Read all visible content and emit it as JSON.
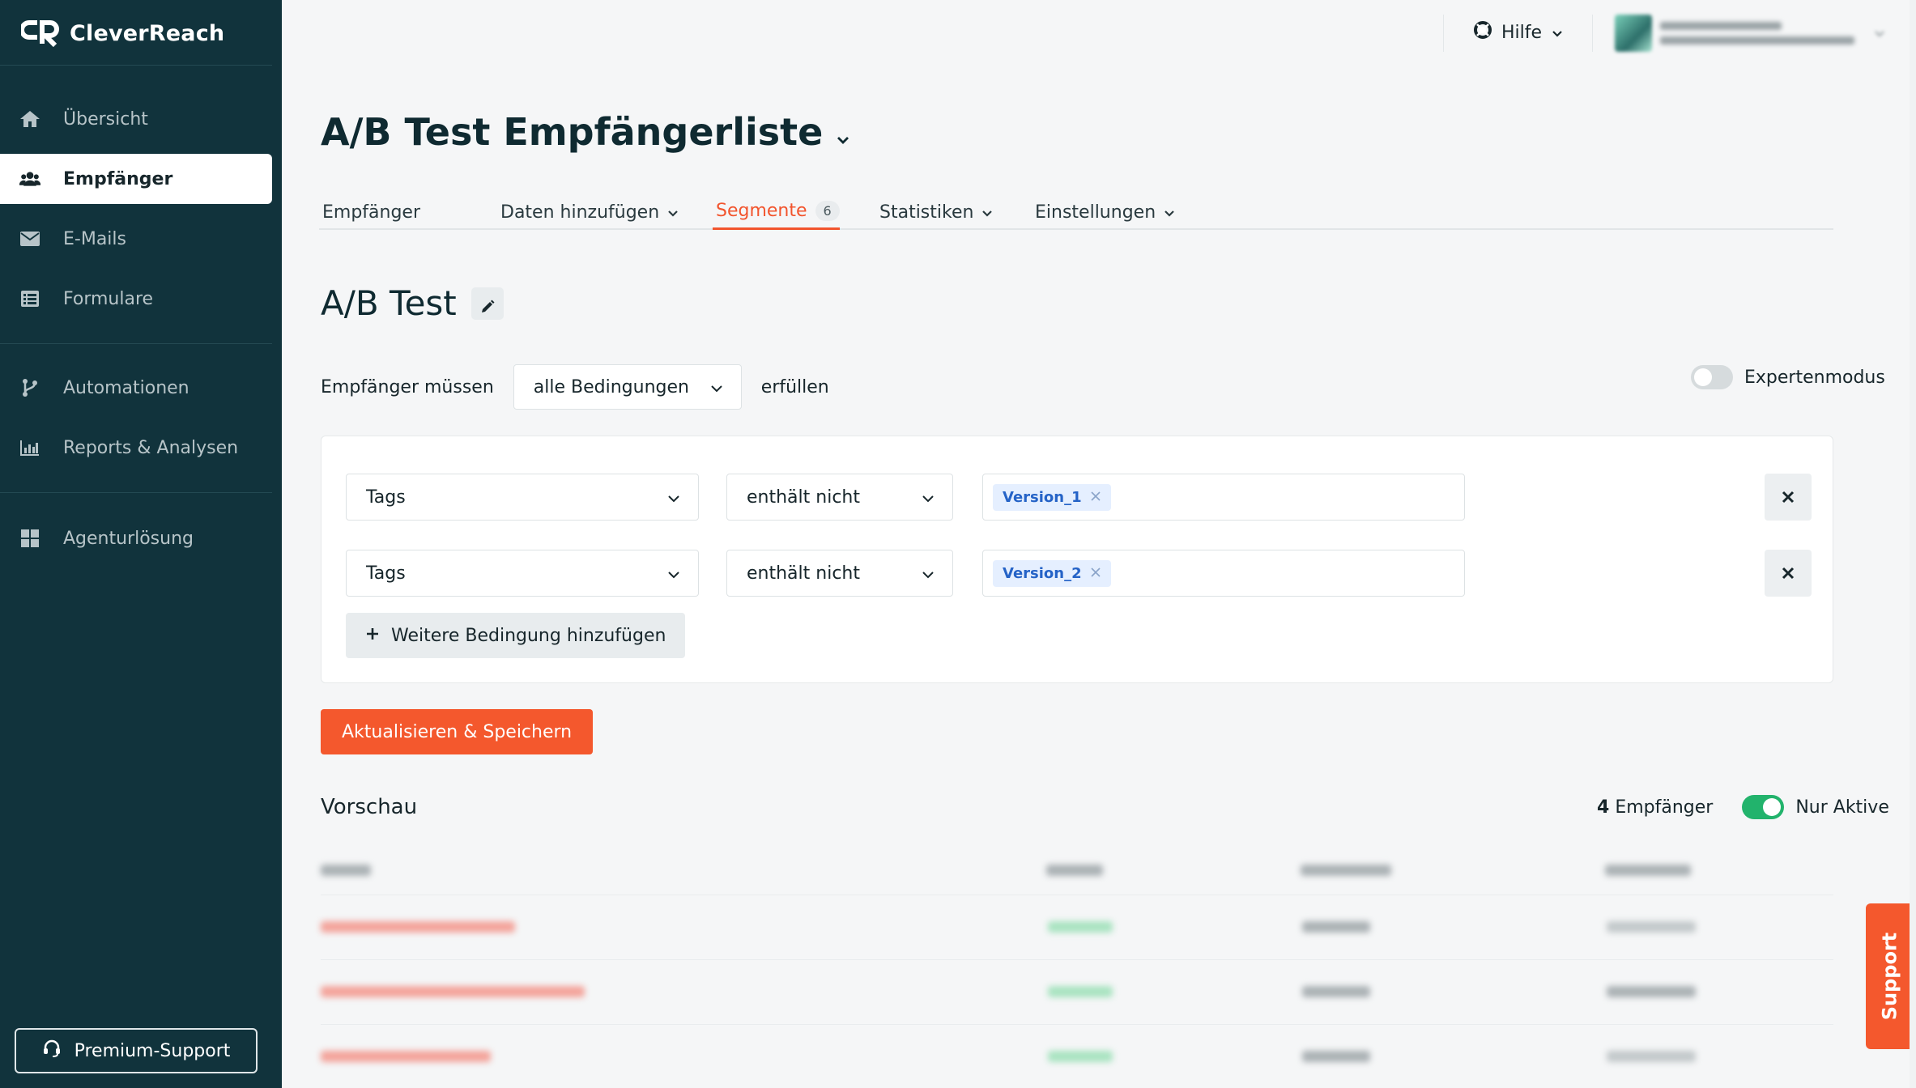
{
  "brand": {
    "name": "CleverReach"
  },
  "sidebar": {
    "items": [
      {
        "label": "Übersicht",
        "icon": "home-icon"
      },
      {
        "label": "Empfänger",
        "icon": "users-icon",
        "active": true
      },
      {
        "label": "E-Mails",
        "icon": "mail-icon"
      },
      {
        "label": "Formulare",
        "icon": "form-icon"
      },
      {
        "label": "Automationen",
        "icon": "branch-icon"
      },
      {
        "label": "Reports & Analysen",
        "icon": "bar-chart-icon"
      },
      {
        "label": "Agenturlösung",
        "icon": "grid-icon"
      }
    ],
    "premium_support": "Premium-Support"
  },
  "topbar": {
    "help_label": "Hilfe"
  },
  "page": {
    "title": "A/B Test Empfängerliste",
    "tabs": [
      {
        "label": "Empfänger"
      },
      {
        "label": "Daten hinzufügen"
      },
      {
        "label": "Segmente",
        "badge": "6",
        "active": true
      },
      {
        "label": "Statistiken"
      },
      {
        "label": "Einstellungen"
      }
    ]
  },
  "segment": {
    "name": "A/B Test",
    "condition_prefix": "Empfänger müssen",
    "condition_mode": "alle Bedingungen",
    "condition_suffix": "erfüllen",
    "expert_mode_label": "Expertenmodus",
    "expert_mode_on": false,
    "rules": [
      {
        "field": "Tags",
        "operator": "enthält nicht",
        "value": "Version_1"
      },
      {
        "field": "Tags",
        "operator": "enthält nicht",
        "value": "Version_2"
      }
    ],
    "add_condition_label": "Weitere Bedingung hinzufügen",
    "save_label": "Aktualisieren & Speichern"
  },
  "preview": {
    "title": "Vorschau",
    "count": "4",
    "count_label": "Empfänger",
    "only_active_label": "Nur Aktive",
    "only_active_on": true
  },
  "support_label": "Support",
  "colors": {
    "accent": "#f4582d",
    "sidebar": "#11333c",
    "toggle_on": "#22b36c",
    "chip": "#e5efff"
  }
}
